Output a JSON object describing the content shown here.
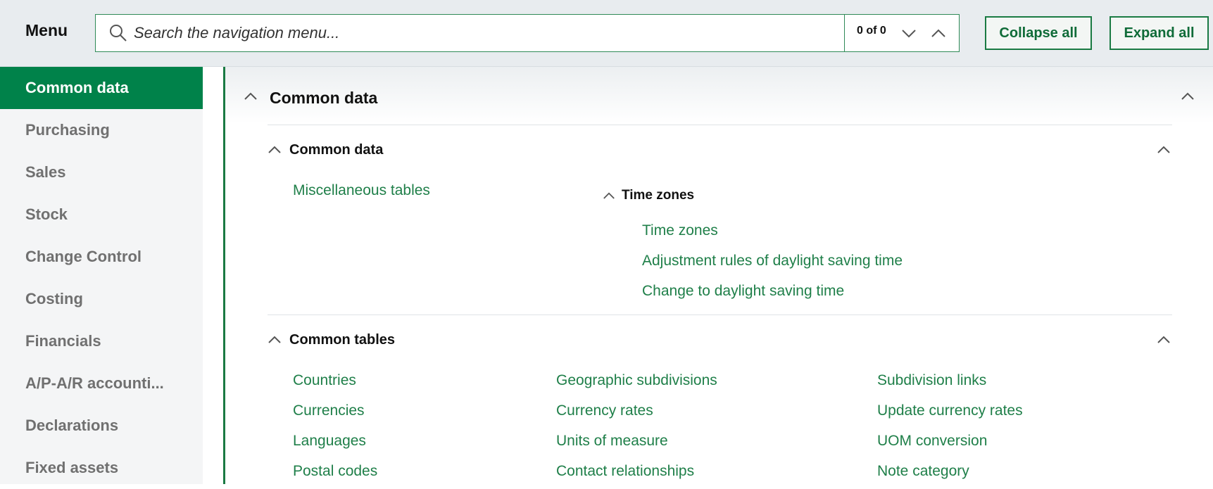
{
  "header": {
    "menu_title": "Menu",
    "search_placeholder": "Search the navigation menu...",
    "search_value": "",
    "match_count": "0 of 0",
    "collapse_all_label": "Collapse all",
    "expand_all_label": "Expand all"
  },
  "sidebar": {
    "items": [
      {
        "label": "Common data",
        "active": true
      },
      {
        "label": "Purchasing"
      },
      {
        "label": "Sales"
      },
      {
        "label": "Stock"
      },
      {
        "label": "Change Control"
      },
      {
        "label": "Costing"
      },
      {
        "label": "Financials"
      },
      {
        "label": "A/P-A/R accounti..."
      },
      {
        "label": "Declarations"
      },
      {
        "label": "Fixed assets"
      }
    ]
  },
  "main": {
    "title": "Common data",
    "common_data": {
      "title": "Common data",
      "links": [
        "Miscellaneous tables"
      ],
      "time_zones": {
        "title": "Time zones",
        "links": [
          "Time zones",
          "Adjustment rules of daylight saving time",
          "Change to daylight saving time"
        ]
      }
    },
    "common_tables": {
      "title": "Common tables",
      "col1": [
        "Countries",
        "Currencies",
        "Languages",
        "Postal codes"
      ],
      "col2": [
        "Geographic subdivisions",
        "Currency rates",
        "Units of measure",
        "Contact relationships"
      ],
      "col3": [
        "Subdivision links",
        "Update currency rates",
        "UOM conversion",
        "Note category"
      ]
    }
  },
  "colors": {
    "brand_green": "#00824a",
    "link_green": "#1f7f49",
    "sidebar_bg": "#f4f5f6",
    "topbar_bg": "#e8ecef"
  }
}
